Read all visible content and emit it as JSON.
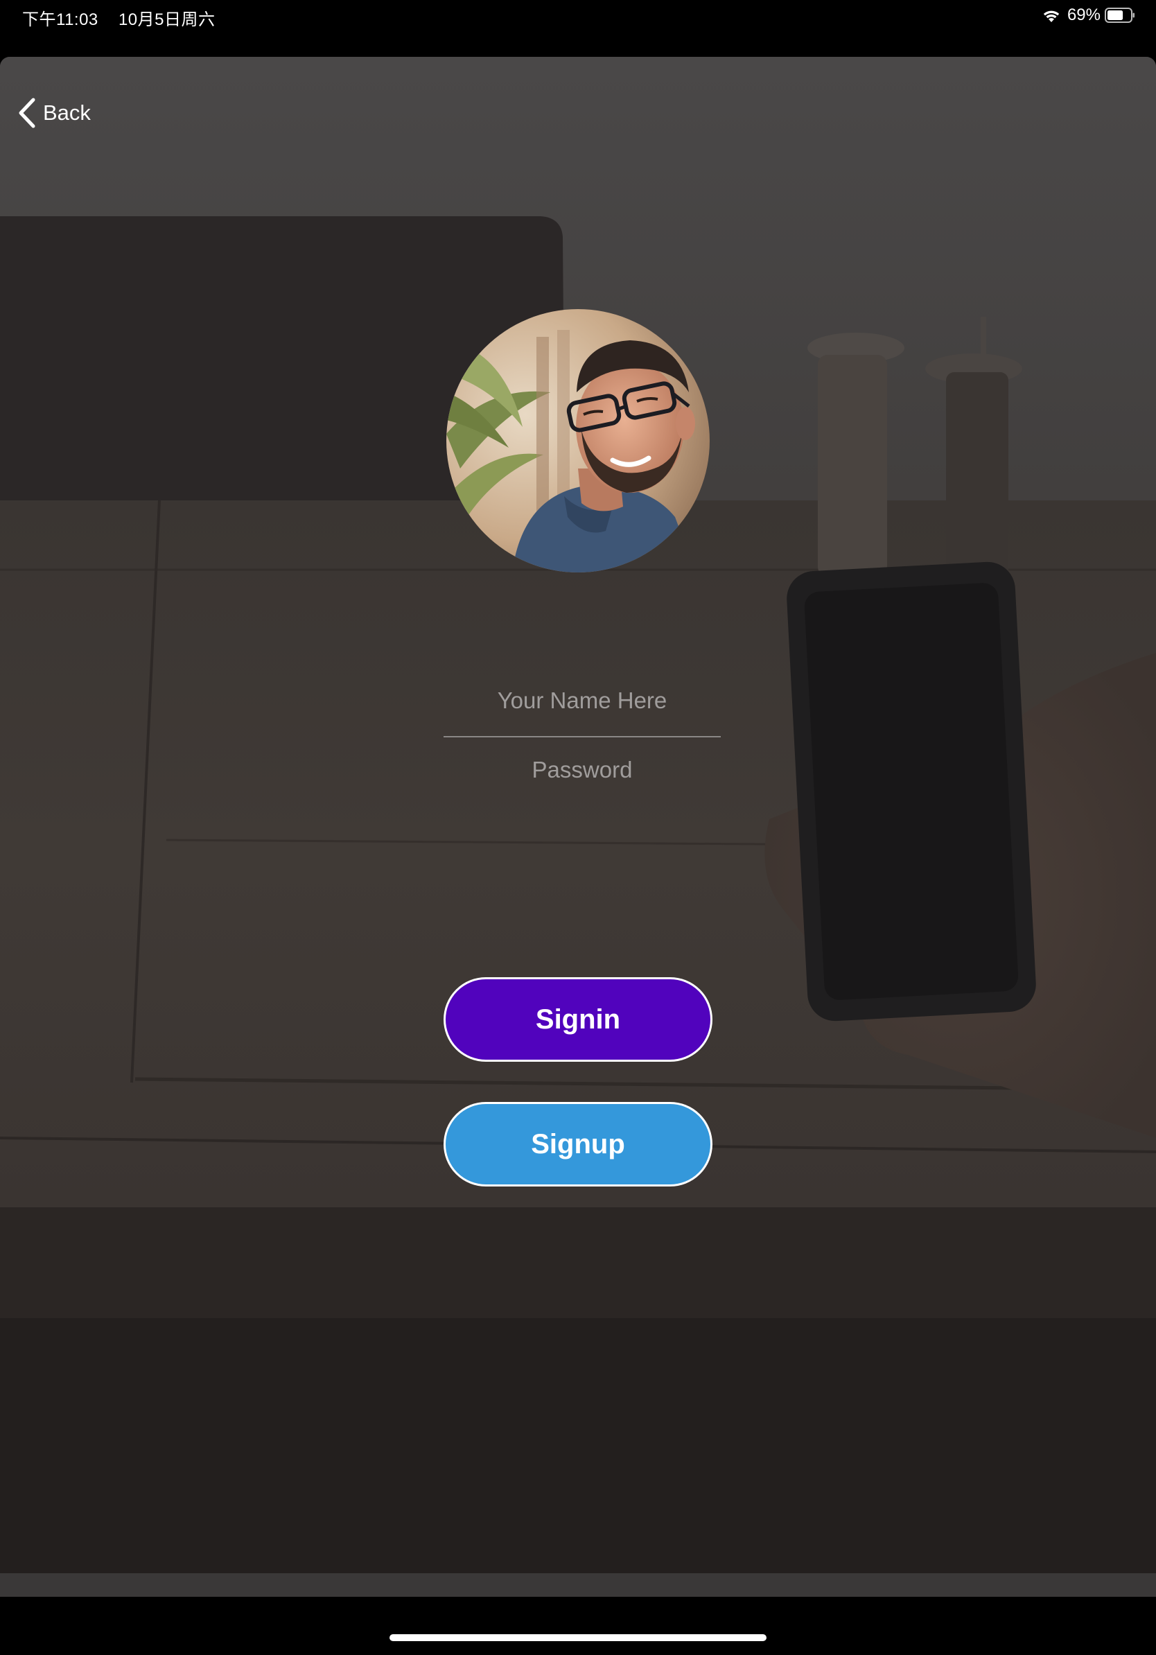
{
  "status_bar": {
    "time": "下午11:03",
    "date": "10月5日周六",
    "battery_percent": "69%",
    "battery_level": 0.69,
    "icons": [
      "wifi-icon",
      "battery-icon"
    ]
  },
  "nav": {
    "back_label": "Back",
    "back_icon": "chevron-left-icon"
  },
  "form": {
    "name_placeholder": "Your Name Here",
    "password_placeholder": "Password"
  },
  "buttons": {
    "signin_label": "Signin",
    "signup_label": "Signup"
  },
  "colors": {
    "signin_bg": "#5103bd",
    "signup_bg": "#3498db",
    "button_border": "#ffffff",
    "placeholder_text": "#9b9898"
  }
}
